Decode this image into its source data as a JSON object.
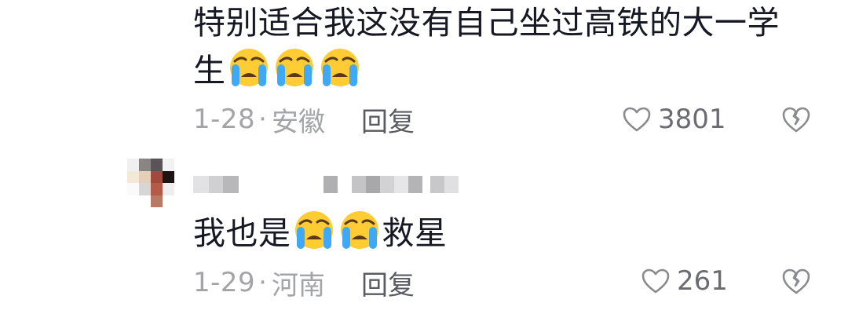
{
  "comments": [
    {
      "text_before": "特别适合我这没有自己坐过高铁的大一学",
      "text_after": "生",
      "emoji_name": "loudly-crying-face",
      "date": "1-28",
      "dot": "·",
      "location": "安徽",
      "reply_label": "回复",
      "likes": "3801"
    },
    {
      "text_before": "我也是",
      "text_after": "救星",
      "emoji_name": "loudly-crying-face",
      "date": "1-29",
      "dot": "·",
      "location": "河南",
      "reply_label": "回复",
      "likes": "261"
    }
  ],
  "colors": {
    "text": "#161823",
    "meta": "#a3a4a8",
    "reply": "#5a5b62",
    "icon": "#8a8b91"
  },
  "icons": {
    "like": "heart-outline-icon",
    "dislike": "broken-heart-outline-icon"
  }
}
